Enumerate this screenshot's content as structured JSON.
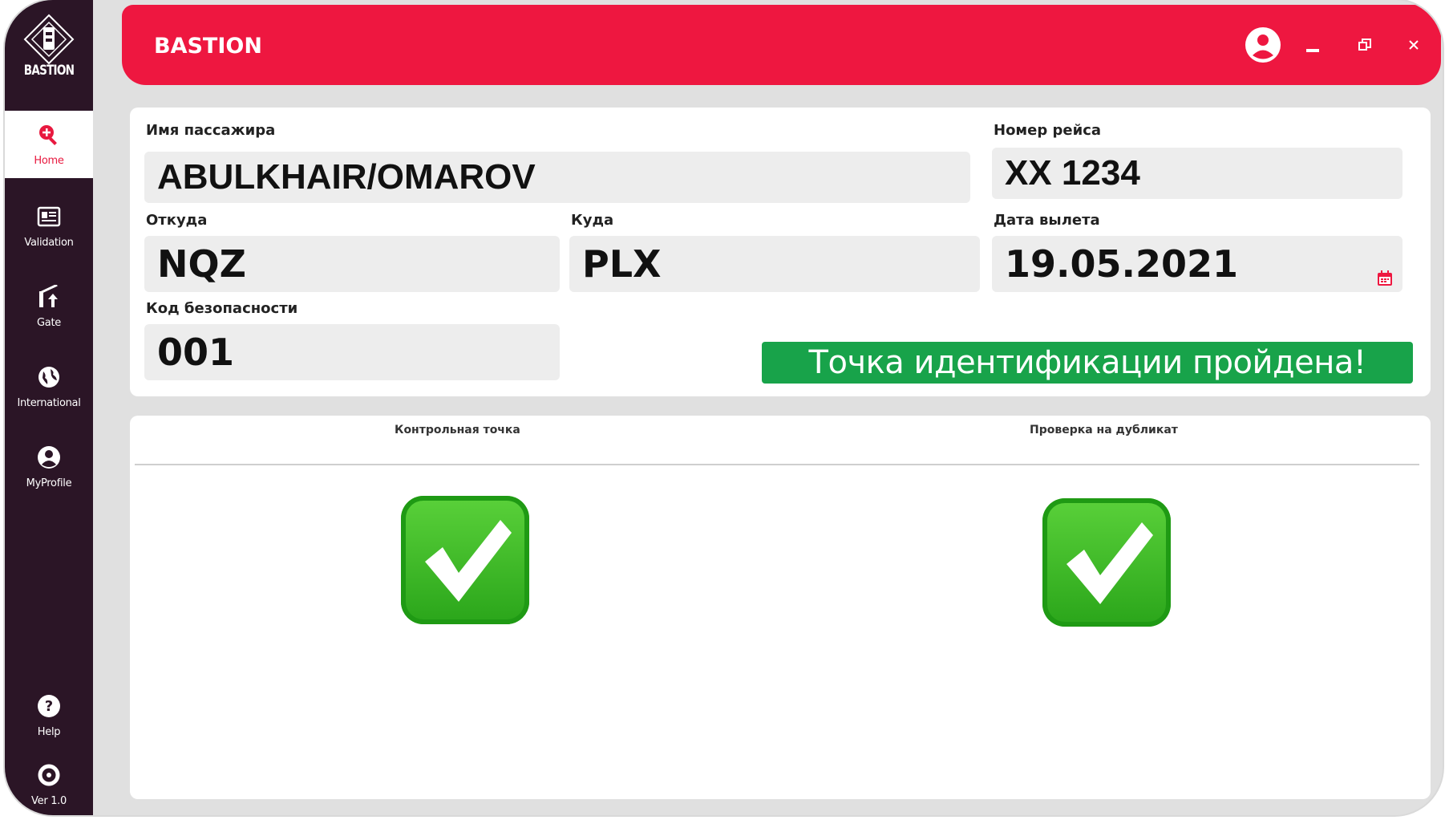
{
  "app": {
    "brand": "BASTION",
    "logo_text": "BASTION",
    "accent_color": "#ee1740",
    "sidebar_color": "#2b1526"
  },
  "sidebar": {
    "items": [
      {
        "label": "Home",
        "icon": "search-plus-icon"
      },
      {
        "label": "Validation",
        "icon": "id-card-icon"
      },
      {
        "label": "Gate",
        "icon": "gate-icon"
      },
      {
        "label": "International",
        "icon": "globe-icon"
      },
      {
        "label": "MyProfile",
        "icon": "user-circle-icon"
      }
    ],
    "bottom": [
      {
        "label": "Help",
        "icon": "help-icon"
      },
      {
        "label": "Ver 1.0",
        "icon": "version-icon"
      }
    ]
  },
  "header": {
    "controls": [
      "user-icon",
      "minimize-icon",
      "restore-icon",
      "close-icon"
    ]
  },
  "form": {
    "passenger_label": "Имя пассажира",
    "passenger_value": "ABULKHAIR/OMAROV",
    "flight_label": "Номер рейса",
    "flight_value": "XX 1234",
    "from_label": "Откуда",
    "from_value": "NQZ",
    "to_label": "Куда",
    "to_value": "PLX",
    "date_label": "Дата вылета",
    "date_value": "19.05.2021",
    "security_label": "Код безопасности",
    "security_value": "001",
    "status_message": "Точка идентификации пройдена!"
  },
  "checks": {
    "col1_header": "Контрольная точка",
    "col2_header": "Проверка на дубликат",
    "col1_status": "check-mark-icon",
    "col2_status": "check-mark-icon"
  }
}
